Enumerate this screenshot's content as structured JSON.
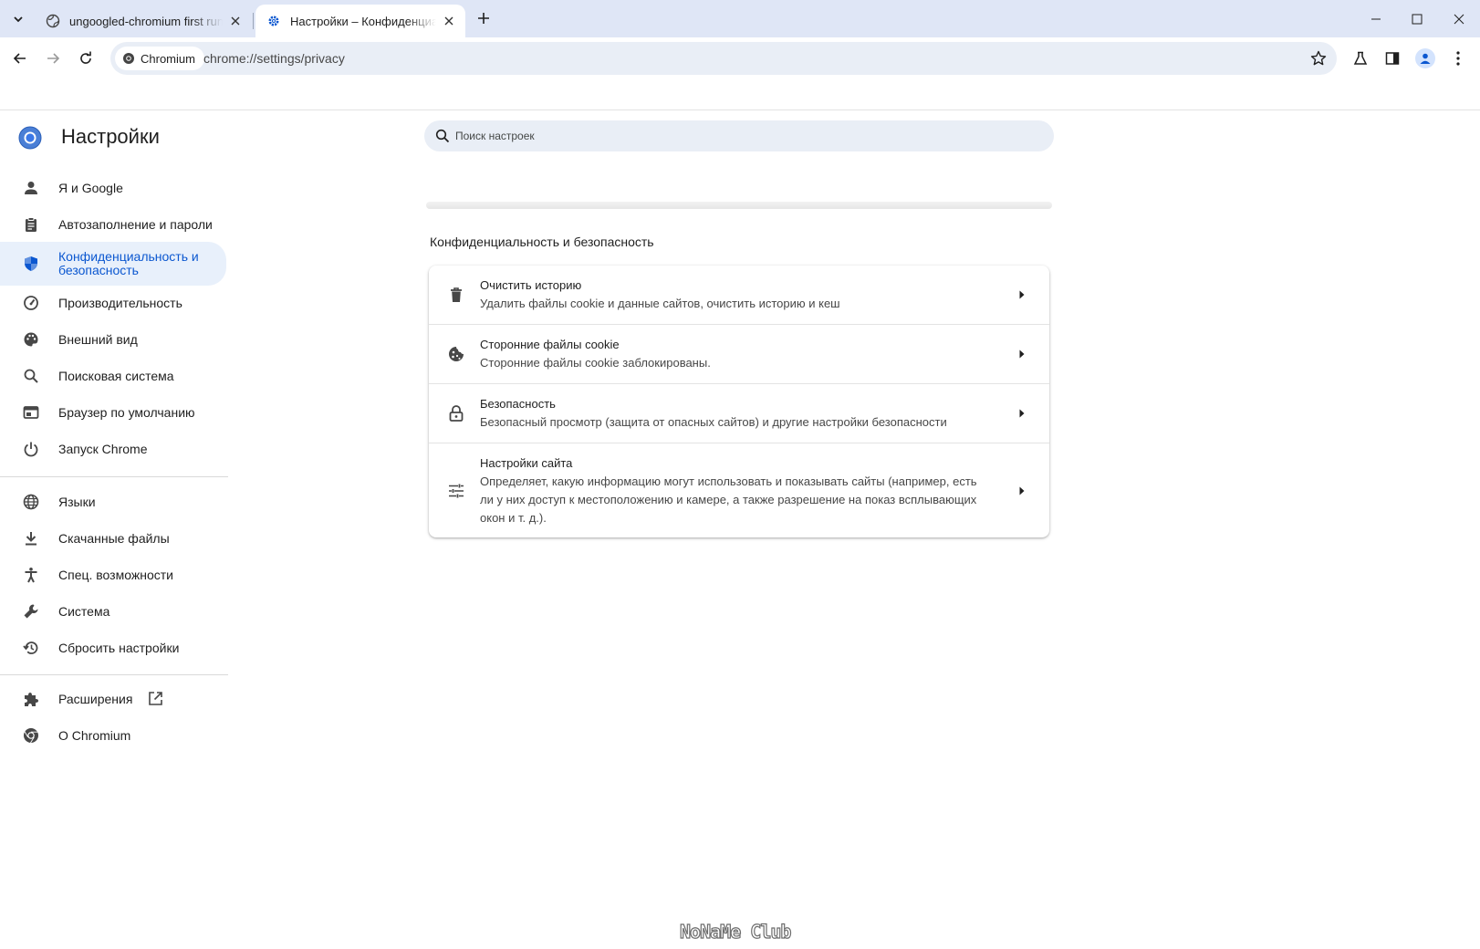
{
  "tabs": [
    {
      "title": "ungoogled-chromium first run",
      "icon": "globe-icon"
    },
    {
      "title": "Настройки – Конфиденциальность и безопасность",
      "icon": "gear-icon"
    }
  ],
  "toolbar": {
    "site_chip": "Chromium",
    "url": "chrome://settings/privacy"
  },
  "settings": {
    "title": "Настройки",
    "search_placeholder": "Поиск настроек"
  },
  "sidebar": {
    "items": [
      {
        "label": "Я и Google",
        "icon": "person-icon"
      },
      {
        "label": "Автозаполнение и пароли",
        "icon": "clipboard-icon"
      },
      {
        "label": "Конфиденциальность и безопасность",
        "icon": "shield-icon",
        "selected": true
      },
      {
        "label": "Производительность",
        "icon": "speedometer-icon"
      },
      {
        "label": "Внешний вид",
        "icon": "palette-icon"
      },
      {
        "label": "Поисковая система",
        "icon": "search-icon"
      },
      {
        "label": "Браузер по умолчанию",
        "icon": "browser-window-icon"
      },
      {
        "label": "Запуск Chrome",
        "icon": "power-icon"
      },
      {
        "label": "Языки",
        "icon": "globe-icon"
      },
      {
        "label": "Скачанные файлы",
        "icon": "download-icon"
      },
      {
        "label": "Спец. возможности",
        "icon": "accessibility-icon"
      },
      {
        "label": "Система",
        "icon": "wrench-icon"
      },
      {
        "label": "Сбросить настройки",
        "icon": "history-icon"
      },
      {
        "label": "Расширения",
        "icon": "puzzle-icon"
      },
      {
        "label": "О Chromium",
        "icon": "chromium-icon"
      }
    ]
  },
  "main": {
    "section_title": "Конфиденциальность и безопасность",
    "rows": [
      {
        "title": "Очистить историю",
        "subtitle": "Удалить файлы cookie и данные сайтов, очистить историю и кеш",
        "icon": "trash-icon"
      },
      {
        "title": "Сторонние файлы cookie",
        "subtitle": "Сторонние файлы cookie заблокированы.",
        "icon": "cookie-icon"
      },
      {
        "title": "Безопасность",
        "subtitle": "Безопасный просмотр (защита от опасных сайтов) и другие настройки безопасности",
        "icon": "lock-icon"
      },
      {
        "title": "Настройки сайта",
        "subtitle": "Определяет, какую информацию могут использовать и показывать сайты (например, есть ли у них доступ к местоположению и камере, а также разрешение на показ всплывающих окон и т. д.).",
        "icon": "tune-icon"
      }
    ]
  },
  "watermark": "NoNaMe Club",
  "colors": {
    "accent": "#0b57d0",
    "selected_bg": "#e8f0fb",
    "tabstrip_bg": "#dfe6f6",
    "omnibox_bg": "#e9eef6"
  }
}
